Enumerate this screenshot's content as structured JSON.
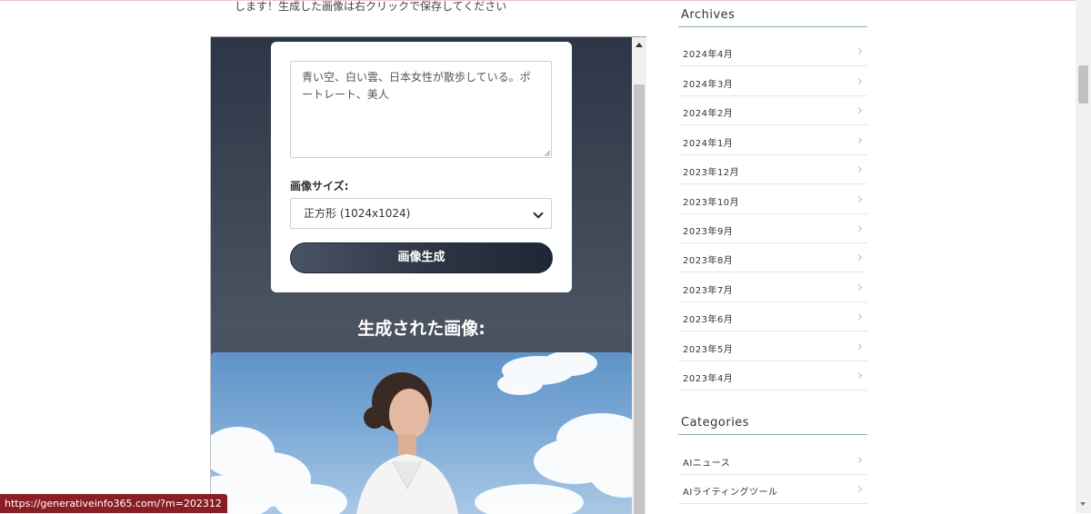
{
  "intro_text": "します！生成した画像は右クリックで保存してください",
  "generator": {
    "prompt_value": "青い空、白い雲、日本女性が散歩している。ポートレート、美人",
    "size_label": "画像サイズ:",
    "size_selected": "正方形 (1024x1024)",
    "generate_button": "画像生成",
    "result_title": "生成された画像:"
  },
  "sidebar": {
    "archives_title": "Archives",
    "archives": [
      "2024年4月",
      "2024年3月",
      "2024年2月",
      "2024年1月",
      " 2023年12月",
      "2023年10月",
      "2023年9月",
      "2023年8月",
      "2023年7月",
      "2023年6月",
      "2023年5月",
      "2023年4月"
    ],
    "categories_title": "Categories",
    "categories": [
      "AIニュース",
      "AIライティングツール"
    ]
  },
  "status_url": "https://generativeinfo365.com/?m=202312",
  "colors": {
    "frame_dark": "#2d3646",
    "button_dark": "#1f2635",
    "status_bg": "#8b1e24",
    "widget_rule": "#8bb0aa"
  }
}
